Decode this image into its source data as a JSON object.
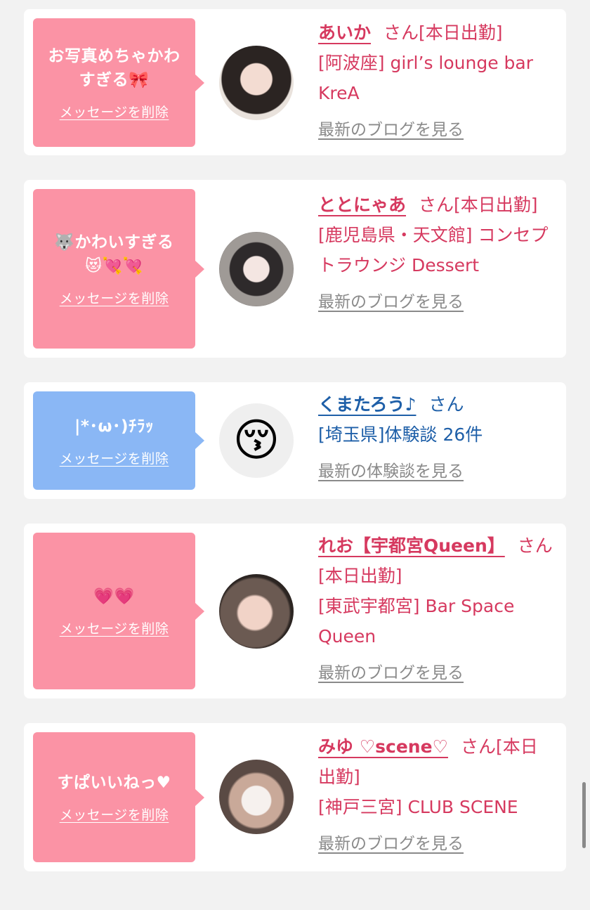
{
  "delete_label": "メッセージを削除",
  "honorific": "さん",
  "colors": {
    "pink": "#fb93a5",
    "blue": "#8ab7f5",
    "name_pink": "#d6395f",
    "name_blue": "#1e5fa8"
  },
  "cards": [
    {
      "message_line1": "お写真めちゃかわ",
      "message_line2": "すぎる🎀",
      "name": "あいか",
      "status": "[本日出勤]",
      "shop": "[阿波座] girl’s lounge bar KreA",
      "more": "最新のブログを見る"
    },
    {
      "message_line1": "🐺かわいすぎる",
      "message_line2": "😻💘💘",
      "name": "ととにゃあ",
      "status": "[本日出勤]",
      "shop": "[鹿児島県・天文館] コンセプトラウンジ Dessert",
      "more": "最新のブログを見る"
    },
    {
      "message_line1": "|*･ω･)ﾁﾗｯ",
      "message_line2": "",
      "name": "くまたろう♪",
      "status": "",
      "shop": "[埼玉県]体験談 26件",
      "more": "最新の体験談を見る",
      "avatar_emoji": "😚"
    },
    {
      "message_line1": "💗💗",
      "message_line2": "",
      "name": "れお【宇都宮Queen】",
      "status": "[本日出勤]",
      "shop": "[東武宇都宮] Bar Space Queen",
      "more": "最新のブログを見る"
    },
    {
      "message_line1": "すぱいいねっ♥",
      "message_line2": "",
      "name": "みゆ ♡scene♡",
      "status": "[本日出勤]",
      "shop": "[神戸三宮] CLUB SCENE",
      "more": "最新のブログを見る"
    }
  ]
}
